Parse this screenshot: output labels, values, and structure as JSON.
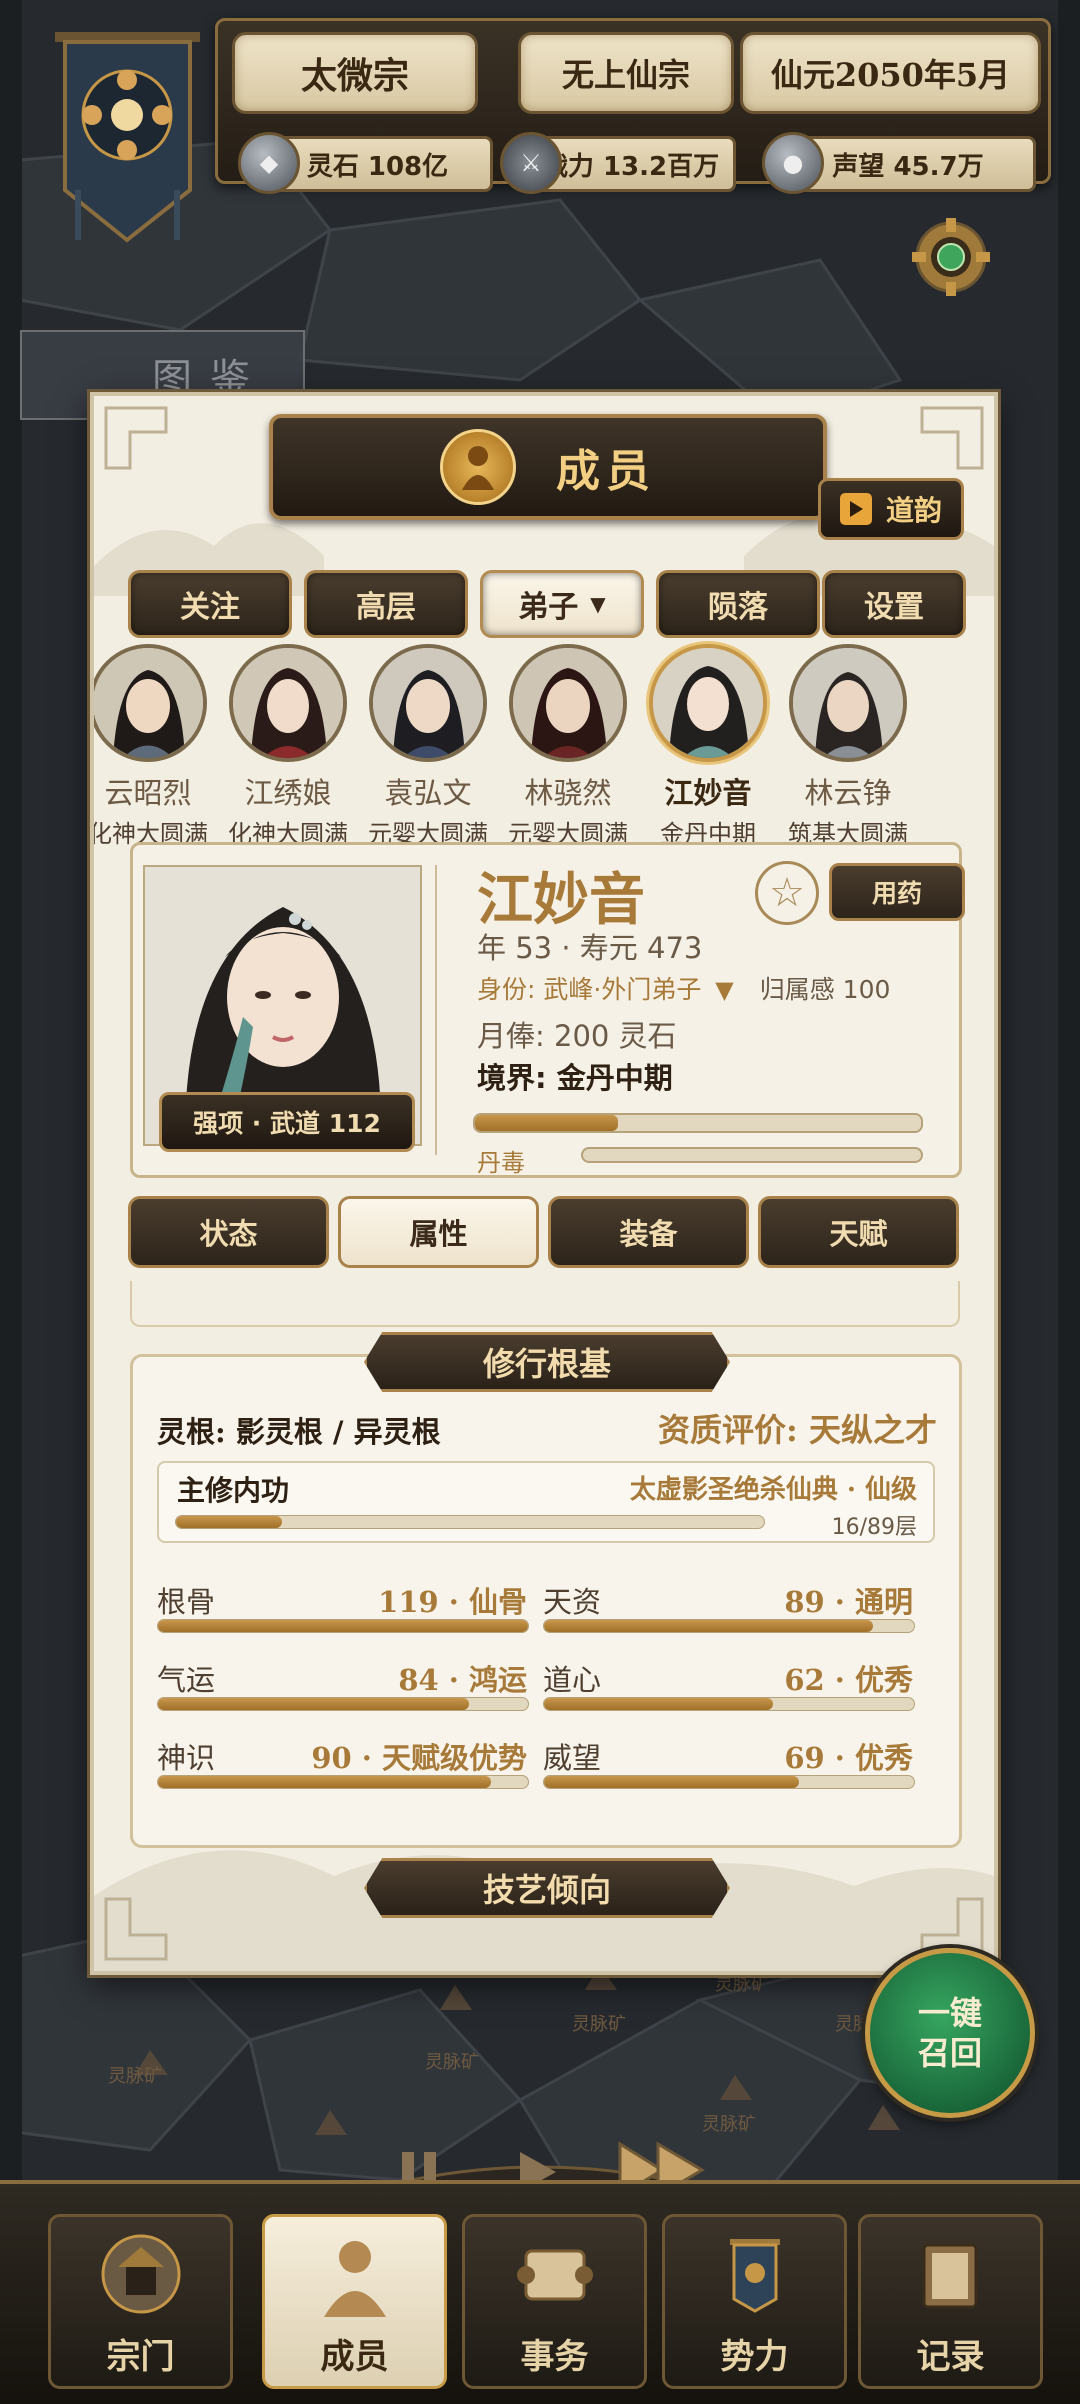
{
  "header": {
    "sect": "太微宗",
    "rank": "无上仙宗",
    "date": "仙元2050年5月",
    "stats": [
      {
        "icon": "spirit-stone-icon",
        "text": "灵石 108亿"
      },
      {
        "icon": "sword-icon",
        "text": "战力 13.2百万"
      },
      {
        "icon": "orb-icon",
        "text": "声望 45.7万"
      }
    ]
  },
  "catalog_tab": "图鉴",
  "panel": {
    "title": "成员",
    "daoyun_label": "道韵",
    "filters": [
      "关注",
      "高层",
      "弟子",
      "陨落",
      "设置"
    ],
    "selected_filter": "弟子",
    "members": [
      {
        "name": "云昭烈",
        "level": "化神大圆满"
      },
      {
        "name": "江绣娘",
        "level": "化神大圆满"
      },
      {
        "name": "袁弘文",
        "level": "元婴大圆满"
      },
      {
        "name": "林骁然",
        "level": "元婴大圆满"
      },
      {
        "name": "江妙音",
        "level": "金丹中期"
      },
      {
        "name": "林云铮",
        "level": "筑基大圆满"
      }
    ],
    "detail": {
      "name": "江妙音",
      "strength": "强项 · 武道 112",
      "use_medicine": "用药",
      "age_line": "年 53 · 寿元 473",
      "identity_label": "身份:",
      "identity_value": "武峰·外门弟子",
      "belonging": "归属感 100",
      "salary": "月俸: 200 灵石",
      "realm_label": "境界:",
      "realm_value": "金丹中期",
      "cultivation_progress": 0.32,
      "poison_label": "丹毒",
      "poison_progress": 0.0
    },
    "tabs": [
      "状态",
      "属性",
      "装备",
      "天赋"
    ],
    "selected_tab": "属性",
    "foundation": {
      "heading": "修行根基",
      "root_label": "灵根:",
      "root_value": "影灵根 / 异灵根",
      "aptitude_label": "资质评价:",
      "aptitude_value": "天纵之才",
      "skill_label": "主修内功",
      "skill_value": "太虚影圣绝杀仙典 · 仙级",
      "skill_layer": "16/89层",
      "skill_progress": 0.18,
      "stats": [
        {
          "label": "根骨",
          "value": "119 · 仙骨",
          "progress": 1.0
        },
        {
          "label": "天资",
          "value": "89 · 通明",
          "progress": 0.89
        },
        {
          "label": "气运",
          "value": "84 · 鸿运",
          "progress": 0.84
        },
        {
          "label": "道心",
          "value": "62 · 优秀",
          "progress": 0.62
        },
        {
          "label": "神识",
          "value": "90 · 天赋级优势",
          "progress": 0.9
        },
        {
          "label": "威望",
          "value": "69 · 优秀",
          "progress": 0.69
        }
      ]
    },
    "next_heading": "技艺倾向"
  },
  "summon": {
    "line1": "一键",
    "line2": "召回"
  },
  "nav": [
    {
      "label": "宗门",
      "icon": "sect-gate-icon"
    },
    {
      "label": "成员",
      "icon": "member-icon"
    },
    {
      "label": "事务",
      "icon": "scroll-icon"
    },
    {
      "label": "势力",
      "icon": "banner-icon"
    },
    {
      "label": "记录",
      "icon": "book-icon"
    }
  ],
  "selected_nav": "成员"
}
